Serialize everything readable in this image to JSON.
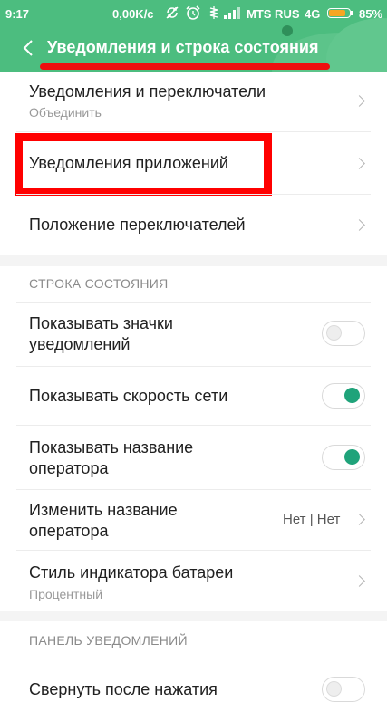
{
  "status_bar": {
    "time": "9:17",
    "speed": "0,00K/c",
    "operator": "MTS RUS",
    "network": "4G",
    "battery": "85%",
    "battery_level": 0.85
  },
  "header": {
    "title": "Уведомления и строка состояния"
  },
  "items": [
    {
      "title": "Уведомления и переключатели",
      "subtitle": "Объединить"
    },
    {
      "title": "Уведомления приложений"
    },
    {
      "title": "Положение переключателей"
    }
  ],
  "sections": {
    "status_bar_title": "СТРОКА СОСТОЯНИЯ",
    "panel_title": "ПАНЕЛЬ УВЕДОМЛЕНИЙ"
  },
  "status_items": [
    {
      "title_line1": "Показывать значки",
      "title_line2": "уведомлений",
      "toggle": false
    },
    {
      "title": "Показывать скорость сети",
      "toggle": true
    },
    {
      "title_line1": "Показывать название",
      "title_line2": "оператора",
      "toggle": true
    },
    {
      "title_line1": "Изменить название",
      "title_line2": "оператора",
      "value": "Нет | Нет"
    },
    {
      "title": "Стиль индикатора батареи",
      "subtitle": "Процентный"
    }
  ],
  "panel_items": [
    {
      "title": "Свернуть после нажатия",
      "toggle": false
    }
  ],
  "colors": {
    "header": "#4cbd7f",
    "toggle_on": "#1fa37a",
    "highlight": "#ff0000"
  }
}
